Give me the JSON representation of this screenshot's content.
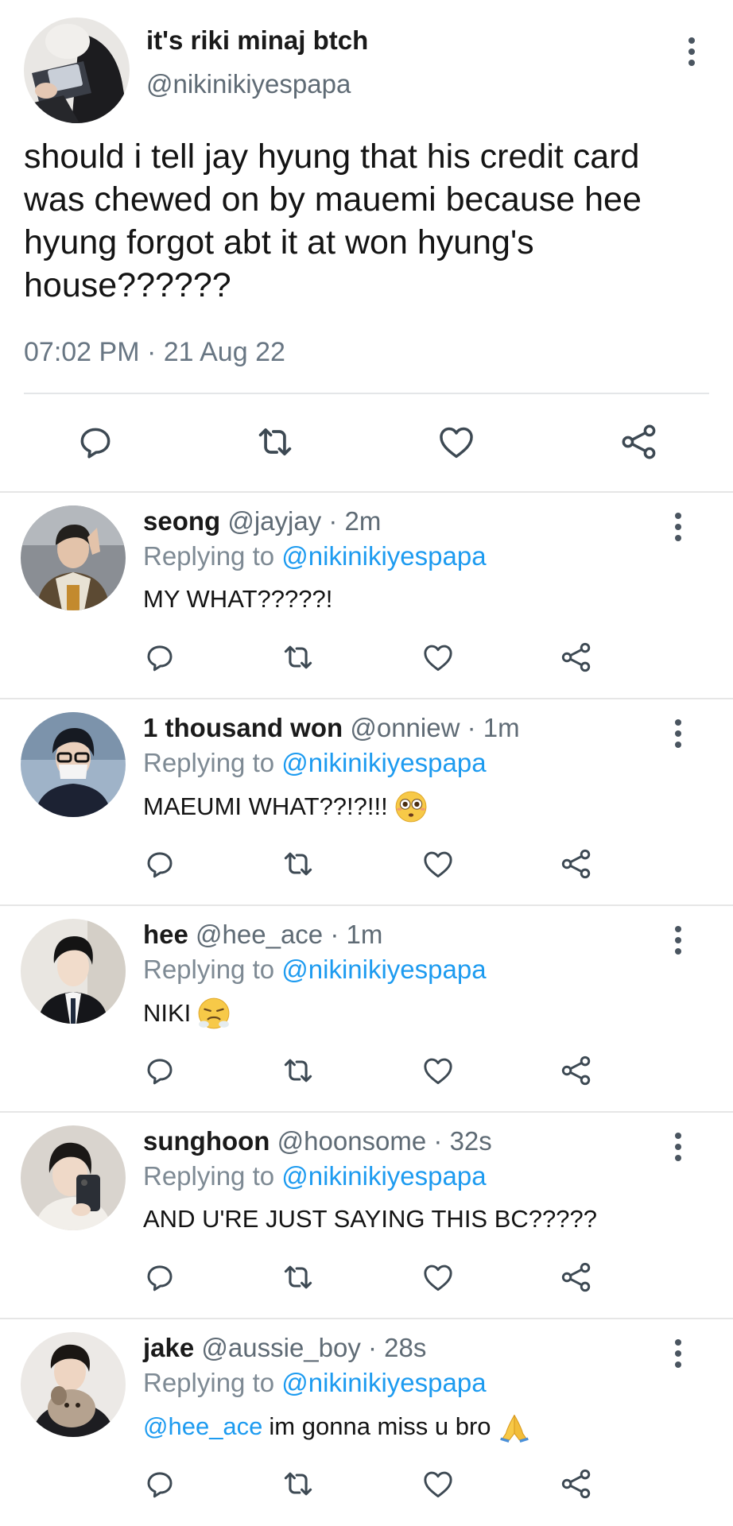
{
  "main_tweet": {
    "display_name": "it's riki minaj btch",
    "handle": "@nikinikiyespapa",
    "text": "should i tell jay hyung that his credit card was chewed on by mauemi because hee hyung forgot abt it at won hyung's house??????",
    "timestamp": "07:02 PM · 21 Aug 22"
  },
  "icons": {
    "reply": "reply-icon",
    "retweet": "retweet-icon",
    "like": "heart-icon",
    "share": "share-icon",
    "more": "more-vertical-icon"
  },
  "colors": {
    "link": "#1d9bf0",
    "icon": "#3d4953",
    "muted": "#687683"
  },
  "replies": [
    {
      "name": "seong",
      "meta": " @jayjay · 2m",
      "replying_prefix": "Replying to ",
      "replying_handle": "@nikinikiyespapa",
      "mention": "",
      "text": "MY WHAT?????!",
      "emoji": ""
    },
    {
      "name": "1 thousand won",
      "meta": " @onniew · 1m",
      "replying_prefix": "Replying to ",
      "replying_handle": "@nikinikiyespapa",
      "mention": "",
      "text": "MAEUMI WHAT??!?!!!",
      "emoji": "flushed-face"
    },
    {
      "name": "hee",
      "meta": " @hee_ace · 1m",
      "replying_prefix": "Replying to ",
      "replying_handle": "@nikinikiyespapa",
      "mention": "",
      "text": "NIKI",
      "emoji": "steam-nose-face"
    },
    {
      "name": "sunghoon",
      "meta": " @hoonsome · 32s",
      "replying_prefix": "Replying to ",
      "replying_handle": "@nikinikiyespapa",
      "mention": "",
      "text": "AND U'RE JUST SAYING THIS BC?????",
      "emoji": ""
    },
    {
      "name": "jake",
      "meta": " @aussie_boy · 28s",
      "replying_prefix": "Replying to ",
      "replying_handle": "@nikinikiyespapa",
      "mention": "@hee_ace",
      "text": "im gonna miss u bro",
      "emoji": "folded-hands"
    }
  ]
}
